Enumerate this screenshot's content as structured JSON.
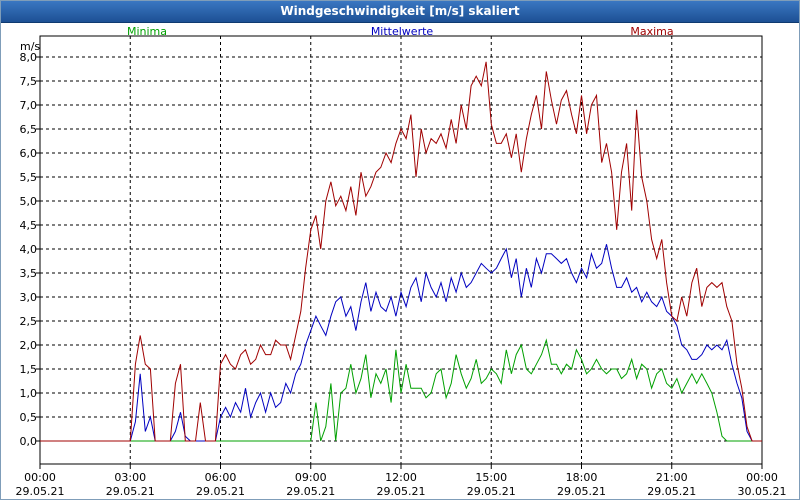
{
  "window": {
    "title": "Windgeschwindigkeit [m/s] skaliert"
  },
  "chart_data": {
    "type": "line",
    "title": "Windgeschwindigkeit [m/s] skaliert",
    "ylabel": "m/s",
    "ylim": [
      0,
      8
    ],
    "yticks": [
      "0,0",
      "0,5",
      "1,0",
      "1,5",
      "2,0",
      "2,5",
      "3,0",
      "3,5",
      "4,0",
      "4,5",
      "5,0",
      "5,5",
      "6,0",
      "6,5",
      "7,0",
      "7,5",
      "8,0"
    ],
    "xlim_hours": [
      0,
      24
    ],
    "xticks": [
      {
        "time": "00:00",
        "date": "29.05.21"
      },
      {
        "time": "03:00",
        "date": "29.05.21"
      },
      {
        "time": "06:00",
        "date": "29.05.21"
      },
      {
        "time": "09:00",
        "date": "29.05.21"
      },
      {
        "time": "12:00",
        "date": "29.05.21"
      },
      {
        "time": "15:00",
        "date": "29.05.21"
      },
      {
        "time": "18:00",
        "date": "29.05.21"
      },
      {
        "time": "21:00",
        "date": "29.05.21"
      },
      {
        "time": "00:00",
        "date": "30.05.21"
      }
    ],
    "grid": true,
    "legend_placement": "top",
    "x_hours": [
      0,
      0.33,
      0.67,
      1,
      1.33,
      1.67,
      2,
      2.33,
      2.67,
      3,
      3.17,
      3.33,
      3.5,
      3.67,
      3.83,
      4,
      4.17,
      4.33,
      4.5,
      4.67,
      4.83,
      5,
      5.17,
      5.33,
      5.5,
      5.67,
      5.83,
      6,
      6.17,
      6.33,
      6.5,
      6.67,
      6.83,
      7,
      7.17,
      7.33,
      7.5,
      7.67,
      7.83,
      8,
      8.17,
      8.33,
      8.5,
      8.67,
      8.83,
      9,
      9.17,
      9.33,
      9.5,
      9.67,
      9.83,
      10,
      10.17,
      10.33,
      10.5,
      10.67,
      10.83,
      11,
      11.17,
      11.33,
      11.5,
      11.67,
      11.83,
      12,
      12.17,
      12.33,
      12.5,
      12.67,
      12.83,
      13,
      13.17,
      13.33,
      13.5,
      13.67,
      13.83,
      14,
      14.17,
      14.33,
      14.5,
      14.67,
      14.83,
      15,
      15.17,
      15.33,
      15.5,
      15.67,
      15.83,
      16,
      16.17,
      16.33,
      16.5,
      16.67,
      16.83,
      17,
      17.17,
      17.33,
      17.5,
      17.67,
      17.83,
      18,
      18.17,
      18.33,
      18.5,
      18.67,
      18.83,
      19,
      19.17,
      19.33,
      19.5,
      19.67,
      19.83,
      20,
      20.17,
      20.33,
      20.5,
      20.67,
      20.83,
      21,
      21.17,
      21.33,
      21.5,
      21.67,
      21.83,
      22,
      22.17,
      22.33,
      22.5,
      22.67,
      22.83,
      23,
      23.17,
      23.33,
      23.5,
      23.67,
      23.83,
      24
    ],
    "series": [
      {
        "name": "Minima",
        "color": "#00a000",
        "values": [
          0,
          0,
          0,
          0,
          0,
          0,
          0,
          0,
          0,
          0,
          0,
          0,
          0,
          0,
          0,
          0,
          0,
          0,
          0,
          0,
          0,
          0,
          0,
          0,
          0,
          0,
          0,
          0,
          0,
          0,
          0,
          0,
          0,
          0,
          0,
          0,
          0,
          0,
          0,
          0,
          0,
          0,
          0,
          0,
          0,
          0,
          0.8,
          0,
          0.3,
          1.2,
          0,
          1.0,
          1.1,
          1.6,
          1.0,
          1.3,
          1.8,
          0.9,
          1.4,
          1.2,
          1.5,
          0.8,
          1.9,
          1.0,
          1.6,
          1.1,
          1.1,
          1.1,
          0.9,
          1.0,
          1.4,
          1.5,
          0.9,
          1.2,
          1.8,
          1.4,
          1.1,
          1.3,
          1.7,
          1.2,
          1.3,
          1.5,
          1.4,
          1.2,
          1.9,
          1.4,
          1.8,
          2.0,
          1.5,
          1.4,
          1.6,
          1.8,
          2.1,
          1.6,
          1.6,
          1.4,
          1.6,
          1.5,
          1.9,
          1.7,
          1.4,
          1.5,
          1.7,
          1.5,
          1.4,
          1.5,
          1.5,
          1.3,
          1.4,
          1.7,
          1.3,
          1.6,
          1.5,
          1.1,
          1.4,
          1.5,
          1.2,
          1.1,
          1.3,
          1.0,
          1.2,
          1.4,
          1.2,
          1.4,
          1.2,
          1.0,
          0.6,
          0.1,
          0,
          0,
          0,
          0,
          0,
          0
        ],
        "min_values": [
          0.0,
          0.0,
          0.0,
          0.0,
          0.0,
          0.0,
          0.0,
          0.0,
          0.0,
          0.0,
          0.0,
          0.0,
          0.0,
          0.0,
          0.0,
          0.0,
          0.0,
          0.0,
          0.0,
          0.0,
          0.0,
          0.0,
          0.0,
          0.0,
          0.0,
          0.0,
          0.0,
          0.0,
          0.0,
          0.0,
          0.0,
          0.0,
          0.0,
          0.0,
          0.0,
          0.0,
          0.0,
          0.0,
          0.0,
          0.0,
          0.0,
          0.0,
          0.0,
          0.0,
          0.0,
          0.0,
          0.0,
          0.0,
          0.0,
          0.0,
          0.0,
          0.0,
          0.0,
          0.0,
          0.0,
          0.0,
          0.0,
          0.0,
          0.0,
          0.0,
          0.0,
          0.0,
          0.0,
          0.0,
          0.0,
          0.0,
          0.0,
          0.0,
          0.0,
          0.0,
          0.0,
          0.0,
          0.0,
          0.0,
          0.0,
          0.0,
          0.0,
          0.0,
          0.0,
          0.0,
          0.0,
          0.0,
          0.0,
          0.0,
          0.0,
          0.0,
          0.0,
          0.0,
          0.0,
          0.0,
          0.0,
          0.0,
          0.0,
          0.0,
          0.0,
          0.0,
          0.0,
          0.0,
          0.0,
          0.0,
          0.0,
          0.0,
          0.0,
          0.0,
          0.0,
          0.0,
          0.0,
          0.0,
          0.0,
          0.0,
          0.0,
          0.0,
          0.0,
          0.0,
          0.0,
          0.0,
          0.0,
          0.0,
          0.0,
          0.0,
          0.0,
          0.0,
          0.0,
          0.0,
          0.0,
          0.0,
          0.0,
          0.0,
          0.0,
          0.0,
          0.0,
          0.0,
          0.0,
          0.0
        ]
      },
      {
        "name": "Mittelwerte",
        "color": "#0000c0",
        "values": [
          0,
          0,
          0,
          0,
          0,
          0,
          0,
          0,
          0,
          0,
          0.4,
          1.4,
          0.2,
          0.5,
          0,
          0,
          0,
          0,
          0.2,
          0.6,
          0.1,
          0,
          0,
          0,
          0,
          0,
          0,
          0.5,
          0.7,
          0.5,
          0.8,
          0.6,
          1.1,
          0.5,
          0.8,
          1.0,
          0.6,
          1.0,
          0.7,
          0.8,
          1.2,
          1.0,
          1.4,
          1.6,
          2.0,
          2.3,
          2.6,
          2.4,
          2.2,
          2.6,
          2.9,
          3.0,
          2.6,
          2.8,
          2.3,
          2.9,
          3.3,
          2.7,
          3.1,
          2.8,
          2.7,
          3.0,
          2.6,
          3.1,
          2.8,
          3.2,
          3.4,
          2.9,
          3.5,
          3.2,
          3.0,
          3.3,
          2.9,
          3.4,
          3.1,
          3.5,
          3.2,
          3.3,
          3.5,
          3.7,
          3.6,
          3.5,
          3.6,
          3.8,
          4.0,
          3.4,
          3.8,
          3.0,
          3.6,
          3.2,
          3.8,
          3.5,
          3.9,
          3.9,
          3.8,
          3.7,
          3.8,
          3.5,
          3.3,
          3.6,
          3.4,
          3.9,
          3.6,
          3.7,
          4.1,
          3.6,
          3.2,
          3.2,
          3.4,
          3.1,
          3.2,
          2.9,
          3.1,
          2.9,
          2.8,
          3.0,
          2.7,
          2.6,
          2.4,
          2.0,
          1.9,
          1.7,
          1.7,
          1.8,
          2.0,
          1.9,
          2.0,
          1.9,
          2.1,
          1.6,
          1.2,
          0.9,
          0.2,
          0,
          0,
          0,
          0,
          0,
          0
        ],
        "min_values": [
          0.0,
          0.0,
          0.0,
          0.0,
          0.0,
          0.0,
          0.0,
          0.0,
          0.0,
          0.0,
          0.0,
          0.0,
          0.0,
          0.0,
          0.0,
          0.0,
          0.0,
          0.0,
          0.0,
          0.0,
          0.0,
          0.0,
          0.0,
          0.0,
          0.0,
          0.0,
          0.0,
          0.0,
          0.0,
          0.0,
          0.0,
          0.0,
          0.0,
          0.0,
          0.0,
          0.0,
          0.0,
          0.0,
          0.0,
          0.0,
          0.0,
          0.0,
          0.0,
          0.0,
          0.0,
          0.0,
          0.0,
          0.0,
          0.0,
          0.0,
          0.0,
          0.0,
          0.0,
          0.0,
          0.0,
          0.0,
          0.0,
          0.0,
          0.0,
          0.0,
          0.0,
          0.0,
          0.0,
          0.0,
          0.0,
          0.0,
          0.0,
          0.0,
          0.0,
          0.0,
          0.0,
          0.0,
          0.0,
          0.0,
          0.0,
          0.0,
          0.0,
          0.0,
          0.0,
          0.0,
          0.0,
          0.0,
          0.0,
          0.0,
          0.0,
          0.0,
          0.0,
          0.0,
          0.0,
          0.0,
          0.0,
          0.0,
          0.0,
          0.0,
          0.0,
          0.0,
          0.0,
          0.0,
          0.0,
          0.0,
          0.0,
          0.0,
          0.0,
          0.0,
          0.0,
          0.0,
          0.0,
          0.0,
          0.0,
          0.0,
          0.0,
          0.0,
          0.0,
          0.0,
          0.0,
          0.0,
          0.0,
          0.0,
          0.0,
          0.0,
          0.0,
          0.0,
          0.0,
          0.0,
          0.0,
          0.0,
          0.0,
          0.0,
          0.0,
          0.0,
          0.0,
          0.0,
          0.0,
          0.0
        ]
      },
      {
        "name": "Maxima",
        "color": "#a00000",
        "values": [
          0,
          0,
          0,
          0,
          0,
          0,
          0,
          0,
          0,
          0,
          1.6,
          2.2,
          1.6,
          1.5,
          0,
          0,
          0,
          0,
          1.2,
          1.6,
          0,
          0,
          0,
          0.8,
          0,
          0,
          0,
          1.6,
          1.8,
          1.6,
          1.5,
          1.8,
          1.9,
          1.6,
          1.7,
          2.0,
          1.8,
          1.8,
          2.1,
          2.0,
          2.0,
          1.7,
          2.2,
          2.7,
          3.6,
          4.4,
          4.7,
          4.0,
          5.0,
          5.4,
          4.9,
          5.1,
          4.8,
          5.3,
          4.7,
          5.6,
          5.1,
          5.3,
          5.6,
          5.7,
          6.0,
          5.8,
          6.2,
          6.5,
          6.3,
          6.8,
          5.5,
          6.5,
          6.0,
          6.3,
          6.2,
          6.4,
          6.1,
          6.7,
          6.2,
          7.0,
          6.5,
          7.4,
          7.6,
          7.4,
          7.9,
          6.6,
          6.2,
          6.2,
          6.4,
          5.9,
          6.4,
          5.6,
          6.3,
          6.8,
          7.2,
          6.5,
          7.7,
          7.1,
          6.6,
          7.1,
          7.3,
          6.8,
          6.4,
          7.2,
          6.4,
          7.0,
          7.2,
          5.8,
          6.2,
          5.6,
          4.4,
          5.6,
          6.2,
          4.8,
          6.9,
          5.5,
          5.0,
          4.2,
          3.8,
          4.2,
          3.3,
          2.6,
          2.5,
          3.0,
          2.6,
          3.3,
          3.6,
          2.8,
          3.2,
          3.3,
          3.2,
          3.3,
          2.8,
          2.5,
          1.6,
          1.1,
          0.3,
          0,
          0,
          0,
          0,
          0
        ],
        "min_values": [
          0.0,
          0.0,
          0.0,
          0.0,
          0.0,
          0.0,
          0.0,
          0.0,
          0.0,
          0.0,
          0.0,
          0.0,
          0.0,
          0.0,
          0.0,
          0.0,
          0.0,
          0.0,
          0.0,
          0.0,
          0.0,
          0.0,
          0.0,
          0.0,
          0.0,
          0.0,
          0.0,
          0.0,
          0.0,
          0.0,
          0.0,
          0.0,
          0.0,
          0.0,
          0.0,
          0.0,
          0.0,
          0.0,
          0.0,
          0.0,
          0.0,
          0.0,
          0.0,
          0.0,
          0.0,
          0.0,
          0.0,
          0.0,
          0.0,
          0.0,
          0.0,
          0.0,
          0.0,
          0.0,
          0.0,
          0.0,
          0.0,
          0.0,
          0.0,
          0.0,
          0.0,
          0.0,
          0.0,
          0.0,
          0.0,
          0.0,
          0.0,
          0.0,
          0.0,
          0.0,
          0.0,
          0.0,
          0.0,
          0.0,
          0.0,
          0.0,
          0.0,
          0.0,
          0.0,
          0.0,
          0.0,
          0.0,
          0.0,
          0.0,
          0.0,
          0.0,
          0.0,
          0.0,
          0.0,
          0.0,
          0.0,
          0.0,
          0.0,
          0.0,
          0.0,
          0.0,
          0.0,
          0.0,
          0.0,
          0.0,
          0.0,
          0.0,
          0.0,
          0.0,
          0.0,
          0.0,
          0.0,
          0.0,
          0.0,
          0.0,
          0.0,
          0.0,
          0.0,
          0.0,
          0.0,
          0.0,
          0.0,
          0.0,
          0.0,
          0.0,
          0.0,
          0.0,
          0.0,
          0.0,
          0.0,
          0.0,
          0.0,
          0.0,
          0.0,
          0.0,
          0.0,
          0.0,
          0.0,
          0.0
        ]
      }
    ]
  }
}
